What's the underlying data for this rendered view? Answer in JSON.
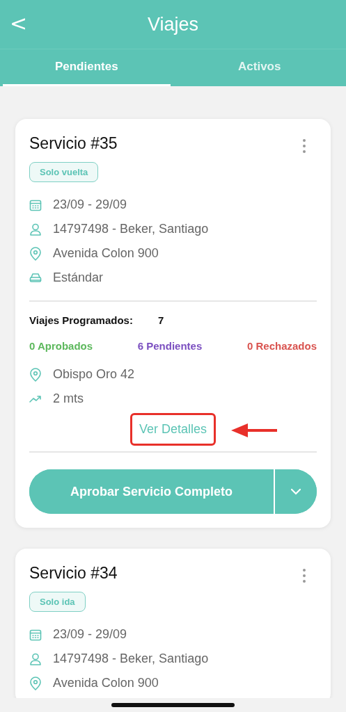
{
  "header": {
    "back": "<",
    "title": "Viajes"
  },
  "tabs": [
    {
      "label": "Pendientes",
      "selected": true
    },
    {
      "label": "Activos",
      "selected": false
    }
  ],
  "services": [
    {
      "title": "Servicio #35",
      "tag": "Solo vuelta",
      "details": [
        {
          "kind": "date",
          "text": "23/09 - 29/09"
        },
        {
          "kind": "person",
          "text": "14797498 - Beker, Santiago"
        },
        {
          "kind": "location",
          "text": "Avenida Colon 900"
        },
        {
          "kind": "vehicle",
          "text": "Estándar"
        }
      ],
      "scheduled": {
        "label": "Viajes Programados:",
        "count": "7",
        "stats": [
          {
            "text": "0 Aprobados",
            "color": "#5cb85c"
          },
          {
            "text": "6 Pendientes",
            "color": "#7b4fc0"
          },
          {
            "text": "0 Rechazados",
            "color": "#d9534f"
          }
        ],
        "details": [
          {
            "kind": "location",
            "text": "Obispo Oro 42"
          },
          {
            "kind": "distance",
            "text": "2 mts"
          }
        ],
        "link": {
          "label": "Ver Detalles",
          "highlighted": true
        }
      },
      "action": "Aprobar Servicio Completo"
    },
    {
      "title": "Servicio #34",
      "tag": "Solo ida",
      "details": [
        {
          "kind": "date",
          "text": "23/09 - 29/09"
        },
        {
          "kind": "person",
          "text": "14797498 - Beker, Santiago"
        },
        {
          "kind": "location",
          "text": "Avenida Colon 900"
        }
      ]
    }
  ]
}
